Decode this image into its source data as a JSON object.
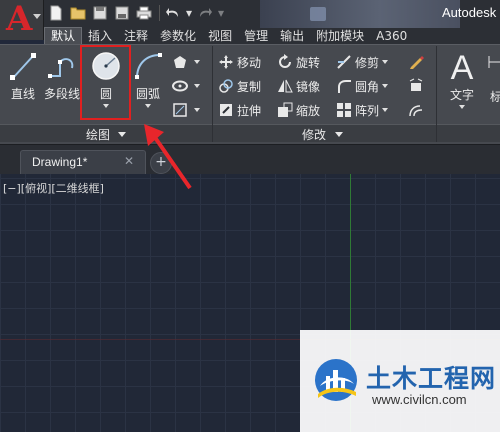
{
  "app": {
    "logo_letter": "A",
    "title": "Autodesk"
  },
  "quick_access": [
    "new-icon",
    "open-icon",
    "save-icon",
    "save-as-icon",
    "print-icon",
    "undo-icon",
    "redo-icon"
  ],
  "ribbon_tabs": [
    {
      "label": "默认",
      "active": true
    },
    {
      "label": "插入"
    },
    {
      "label": "注释"
    },
    {
      "label": "参数化"
    },
    {
      "label": "视图"
    },
    {
      "label": "管理"
    },
    {
      "label": "输出"
    },
    {
      "label": "附加模块"
    },
    {
      "label": "A360"
    }
  ],
  "draw_panel": {
    "title": "绘图",
    "line": "直线",
    "polyline": "多段线",
    "circle": "圆",
    "arc": "圆弧"
  },
  "modify_panel": {
    "title": "修改",
    "move": "移动",
    "rotate": "旋转",
    "trim": "修剪",
    "copy": "复制",
    "mirror": "镜像",
    "fillet": "圆角",
    "stretch": "拉伸",
    "scale": "缩放",
    "array": "阵列"
  },
  "annotation_panel": {
    "text": "文字",
    "dim_partial": "标"
  },
  "document": {
    "tab_name": "Drawing1*",
    "close_glyph": "✕",
    "new_tab_glyph": "+"
  },
  "viewport": {
    "label": "[−][俯视][二维线框]"
  },
  "watermark": {
    "name": "土木工程网",
    "url": "www.civilcn.com"
  },
  "colors": {
    "highlight_red": "#e02020",
    "autocad_red": "#d7262b",
    "canvas_bg": "#212837",
    "watermark_blue": "#2364ae"
  }
}
